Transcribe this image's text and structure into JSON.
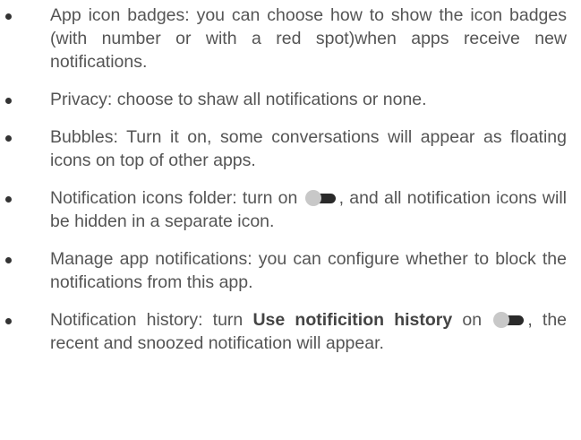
{
  "items": [
    {
      "text": "App icon badges: you can choose how to show the icon badges (with number or with a red spot)when apps receive new notifications."
    },
    {
      "text": "Privacy: choose to shaw all notifications or none."
    },
    {
      "text": "Bubbles: Turn it on, some conversations will appear as floating icons on top of other apps."
    },
    {
      "text_before": "Notification icons folder: turn on",
      "toggle_icon": "toggle-switch-icon",
      "text_after": ", and all notification icons will be hidden in a separate icon."
    },
    {
      "text": "Manage app notifications: you can configure whether to block the notifications from this app."
    },
    {
      "text_before": "Notification history: turn ",
      "bold": "Use notificition history",
      "text_middle": " on",
      "toggle_icon": "toggle-switch-icon",
      "text_after": ", the recent and snoozed notification will appear."
    }
  ],
  "colors": {
    "text": "#555555",
    "bullet": "#333333",
    "toggle_track": "#2a2a2a",
    "toggle_knob": "#c8c8c8"
  }
}
